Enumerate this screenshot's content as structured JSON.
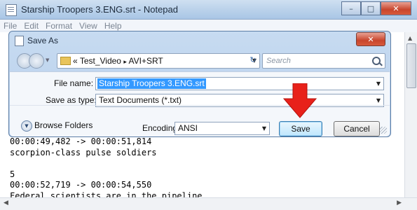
{
  "notepad": {
    "title": "Starship Troopers 3.ENG.srt - Notepad",
    "controls": {
      "minimize": "–",
      "maximize": "□",
      "close": "✕"
    },
    "menu": [
      "File",
      "Edit",
      "Format",
      "View",
      "Help"
    ],
    "text_lines": [
      "00:00:49,482 -> 00:00:51,814",
      "scorpion-class pulse soldiers",
      "",
      "5",
      "00:00:52,719 -> 00:00:54,550",
      "Federal scientists are in the pipeline ... ..."
    ]
  },
  "dialog": {
    "title": "Save As",
    "close": "✕",
    "address": {
      "chevron": "«",
      "path": [
        "Test_Video",
        "AVI+SRT"
      ],
      "separator": "▸"
    },
    "search_placeholder": "Search",
    "file_name_label": "File name:",
    "file_name_value": "Starship Troopers 3.ENG.srt",
    "save_as_type_label": "Save as type:",
    "save_as_type_value": "Text Documents (*.txt)",
    "browse_folders_label": "Browse Folders",
    "encoding_label": "Encoding:",
    "encoding_value": "ANSI",
    "save_label": "Save",
    "cancel_label": "Cancel"
  },
  "colors": {
    "highlight": "#3399ff",
    "arrow": "#e8211a",
    "title_bar": "#b9d1ea"
  }
}
